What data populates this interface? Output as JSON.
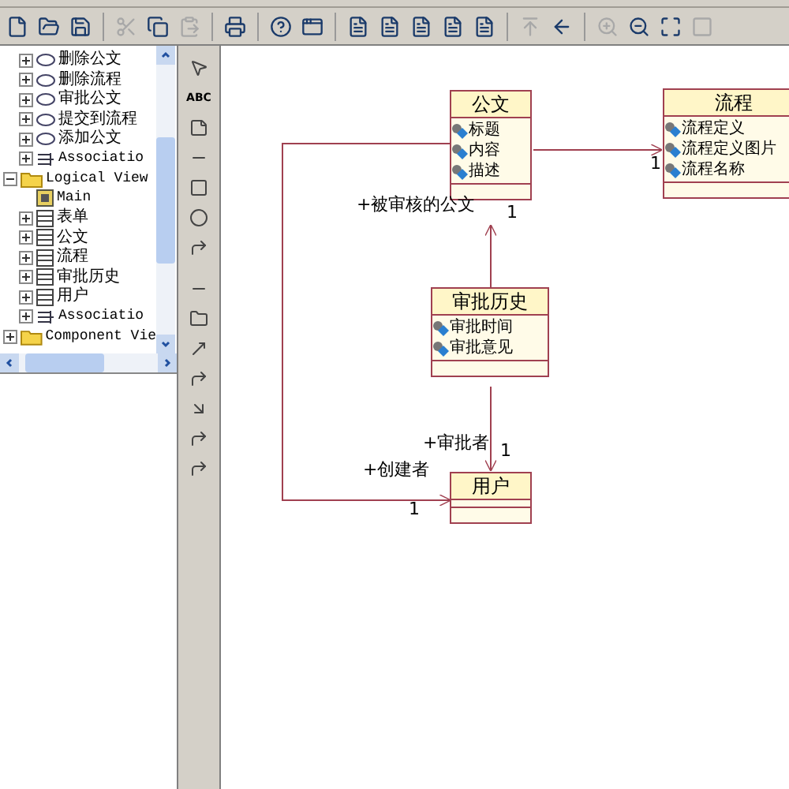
{
  "toolbar": [
    {
      "kind": "new",
      "disabled": false
    },
    {
      "kind": "open",
      "disabled": false
    },
    {
      "kind": "save",
      "disabled": false
    },
    {
      "kind": "sep"
    },
    {
      "kind": "cut",
      "disabled": true
    },
    {
      "kind": "copy",
      "disabled": false
    },
    {
      "kind": "paste",
      "disabled": true
    },
    {
      "kind": "sep"
    },
    {
      "kind": "print",
      "disabled": false
    },
    {
      "kind": "sep"
    },
    {
      "kind": "context-help",
      "disabled": false
    },
    {
      "kind": "window",
      "disabled": false
    },
    {
      "kind": "sep"
    },
    {
      "kind": "doc",
      "disabled": false
    },
    {
      "kind": "doc",
      "disabled": false
    },
    {
      "kind": "doc",
      "disabled": false
    },
    {
      "kind": "doc",
      "disabled": false
    },
    {
      "kind": "doc",
      "disabled": false
    },
    {
      "kind": "sep"
    },
    {
      "kind": "up",
      "disabled": true
    },
    {
      "kind": "back",
      "disabled": false
    },
    {
      "kind": "sep"
    },
    {
      "kind": "zoom-in",
      "disabled": true
    },
    {
      "kind": "zoom-out",
      "disabled": false
    },
    {
      "kind": "fit",
      "disabled": false
    },
    {
      "kind": "page",
      "disabled": true
    }
  ],
  "tree": {
    "scrolled_items": [
      {
        "label": "删除公文",
        "kind": "usecase"
      },
      {
        "label": "删除流程",
        "kind": "usecase"
      },
      {
        "label": "审批公文",
        "kind": "usecase"
      },
      {
        "label": "提交到流程",
        "kind": "usecase"
      },
      {
        "label": "添加公文",
        "kind": "usecase"
      },
      {
        "label": "Associatio",
        "kind": "association"
      }
    ],
    "nodes": [
      {
        "label": "Logical View",
        "kind": "folder",
        "expanded": true,
        "children": [
          {
            "label": "Main",
            "kind": "diagram"
          },
          {
            "label": "表单",
            "kind": "class"
          },
          {
            "label": "公文",
            "kind": "class"
          },
          {
            "label": "流程",
            "kind": "class"
          },
          {
            "label": "审批历史",
            "kind": "class"
          },
          {
            "label": "用户",
            "kind": "class"
          },
          {
            "label": "Associatio",
            "kind": "association"
          }
        ]
      },
      {
        "label": "Component Vie",
        "kind": "folder",
        "expanded": false
      }
    ]
  },
  "toolbox": [
    {
      "kind": "select"
    },
    {
      "kind": "text",
      "label": "ABC"
    },
    {
      "kind": "note"
    },
    {
      "kind": "line"
    },
    {
      "kind": "class"
    },
    {
      "kind": "interface"
    },
    {
      "kind": "assoc"
    },
    {
      "kind": "sep"
    },
    {
      "kind": "line"
    },
    {
      "kind": "package"
    },
    {
      "kind": "arrow"
    },
    {
      "kind": "corner"
    },
    {
      "kind": "dep"
    },
    {
      "kind": "corner"
    },
    {
      "kind": "corner"
    }
  ],
  "diagram": {
    "classes": [
      {
        "name": "公文",
        "attributes": [
          "标题",
          "内容",
          "描述"
        ]
      },
      {
        "name": "流程",
        "attributes": [
          "流程定义",
          "流程定义图片",
          "流程名称"
        ]
      },
      {
        "name": "审批历史",
        "attributes": [
          "审批时间",
          "审批意见"
        ]
      },
      {
        "name": "用户"
      }
    ],
    "labels": [
      {
        "text": "+被审核的公文"
      },
      {
        "text": "1"
      },
      {
        "text": "1"
      },
      {
        "text": "+审批者"
      },
      {
        "text": "1"
      },
      {
        "text": "+创建者"
      },
      {
        "text": "1"
      }
    ]
  }
}
